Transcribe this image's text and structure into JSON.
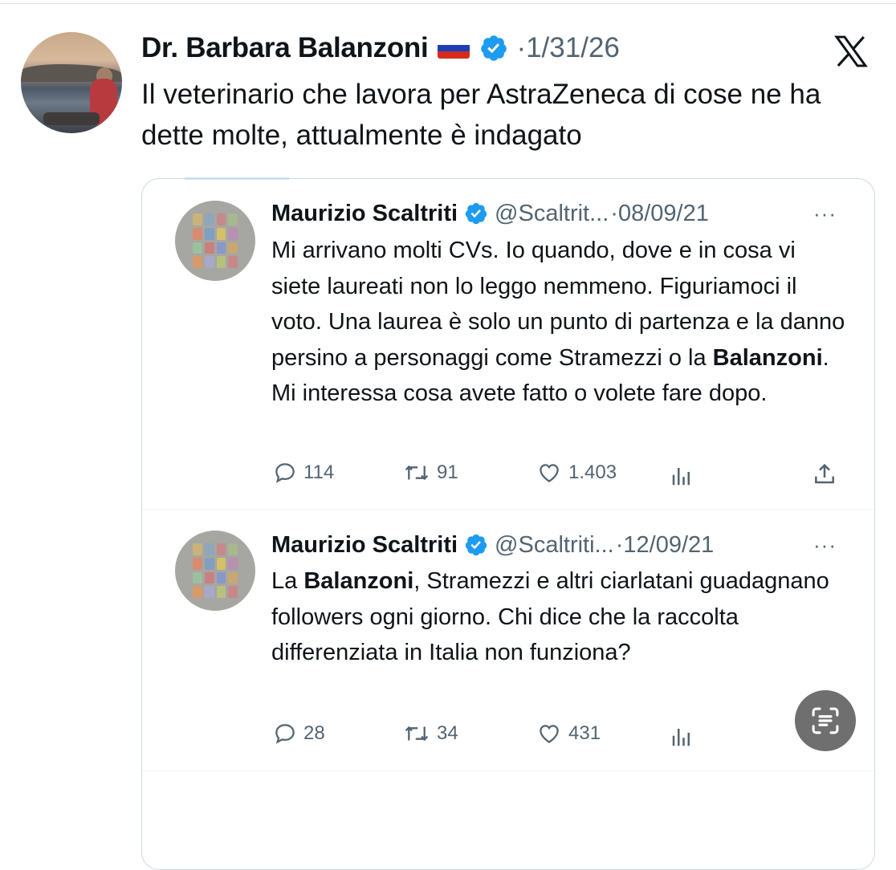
{
  "post": {
    "author_name": "Dr. Barbara Balanzoni",
    "separator": "·",
    "date": "1/31/26",
    "text": "Il veterinario che lavora per AstraZeneca di cose ne ha dette molte, attualmente è indagato",
    "flag_icon": "russia-flag-icon",
    "verified_icon": "verified-badge-icon",
    "platform_icon": "x-logo-icon"
  },
  "quoted_tweets": [
    {
      "author_name": "Maurizio Scaltriti",
      "handle": "@Scaltrit...",
      "separator": "·",
      "date": "08/09/21",
      "more": "···",
      "text_before": "Mi arrivano molti CVs. Io quando, dove e in cosa vi siete laureati non lo leggo nemmeno. Figuriamoci il voto. Una laurea è solo un punto di partenza e la danno persino a personaggi come Stramezzi o la ",
      "text_bold": "Balanzoni",
      "text_after": ". Mi interessa cosa avete fatto o volete fare dopo.",
      "replies": "114",
      "retweets": "91",
      "likes": "1.403"
    },
    {
      "author_name": "Maurizio Scaltriti",
      "handle": "@Scaltriti...",
      "separator": "·",
      "date": "12/09/21",
      "more": "···",
      "text_before": "La ",
      "text_bold": "Balanzoni",
      "text_after": ", Stramezzi e altri ciarlatani guadagnano followers ogni giorno. Chi dice che la raccolta differenziata in Italia non funziona?",
      "replies": "28",
      "retweets": "34",
      "likes": "431"
    }
  ],
  "colors": {
    "text": "#0f1419",
    "muted": "#536471",
    "verified_blue": "#1d9bf0",
    "border": "#cfd9de",
    "fab_gray": "#6f6f6f"
  },
  "icons": {
    "reply": "reply-bubble-icon",
    "retweet": "retweet-icon",
    "like": "heart-icon",
    "views": "views-bar-chart-icon",
    "share": "share-upload-icon",
    "scan": "text-scan-icon"
  }
}
